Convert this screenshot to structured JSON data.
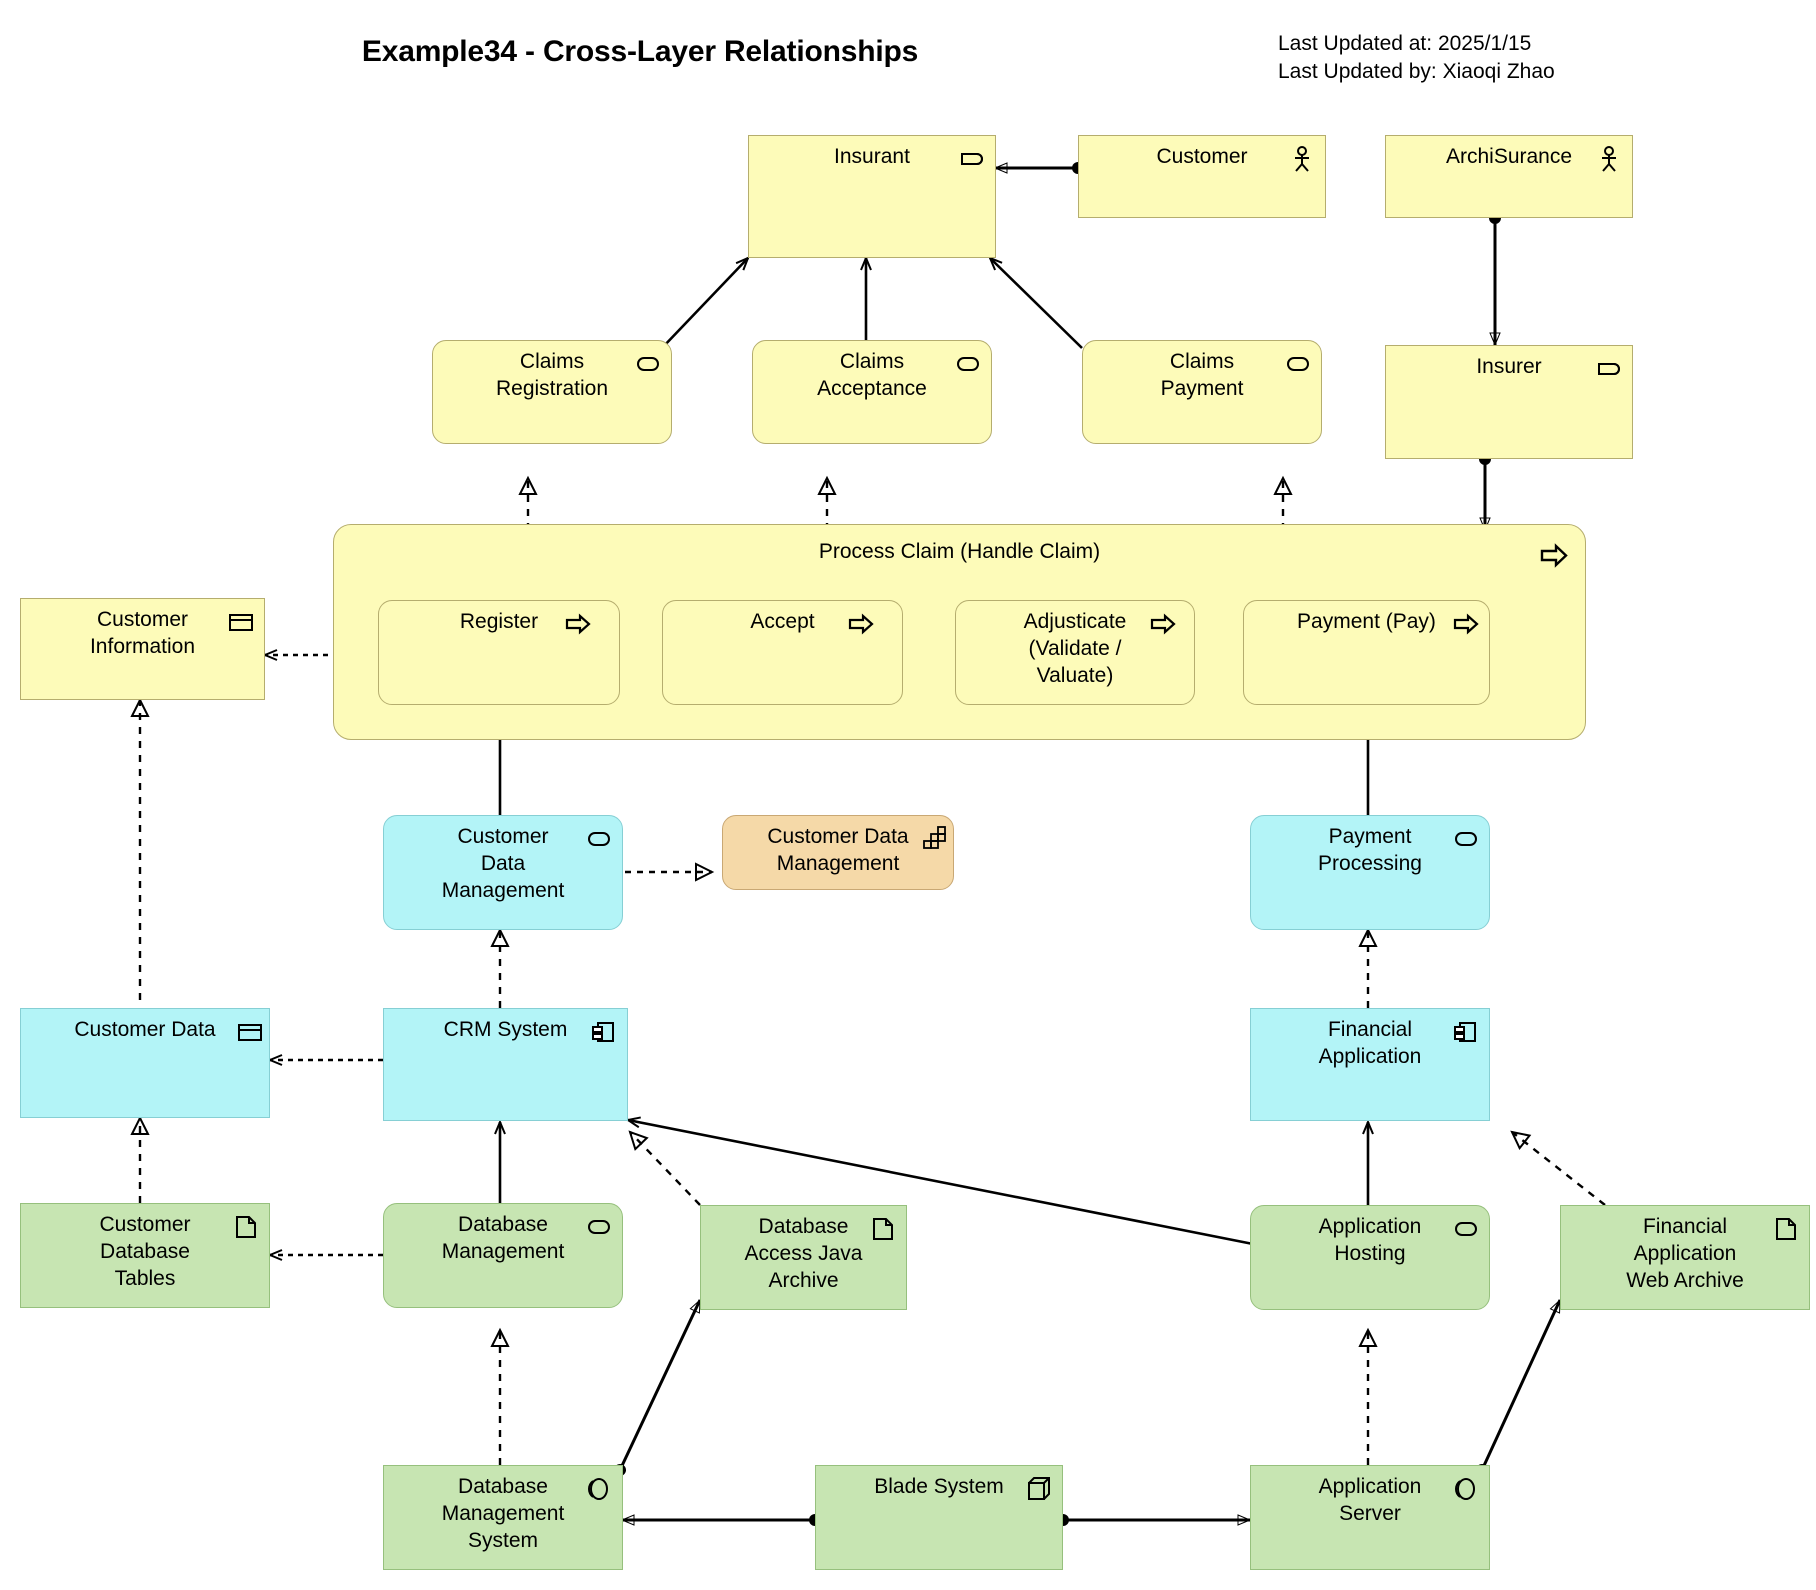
{
  "header": {
    "title": "Example34 - Cross-Layer Relationships",
    "last_updated_at": "Last Updated at: 2025/1/15",
    "last_updated_by": "Last Updated by: Xiaoqi Zhao"
  },
  "colors": {
    "business_fill": "#fdfbb9",
    "business_stroke": "#b5ad6e",
    "application_fill": "#b3f4f7",
    "application_stroke": "#86cfd4",
    "technology_fill": "#c7e5b2",
    "technology_stroke": "#96c07d",
    "motivation_fill": "#f5d9a8",
    "motivation_stroke": "#c9a874",
    "line": "#000000"
  },
  "nodes": {
    "insurant": {
      "label": "Insurant",
      "icon": "business-role-icon",
      "layer": "business"
    },
    "customer": {
      "label": "Customer",
      "icon": "business-actor-icon",
      "layer": "business"
    },
    "archisurance": {
      "label": "ArchiSurance",
      "icon": "business-actor-icon",
      "layer": "business"
    },
    "insurer": {
      "label": "Insurer",
      "icon": "business-role-icon",
      "layer": "business"
    },
    "claims_registration": {
      "label": "Claims\nRegistration",
      "icon": "business-service-icon",
      "layer": "business"
    },
    "claims_acceptance": {
      "label": "Claims\nAcceptance",
      "icon": "business-service-icon",
      "layer": "business"
    },
    "claims_payment": {
      "label": "Claims\nPayment",
      "icon": "business-service-icon",
      "layer": "business"
    },
    "process_claim": {
      "label": "Process Claim (Handle Claim)",
      "icon": "business-process-icon",
      "layer": "business"
    },
    "register": {
      "label": "Register",
      "icon": "business-process-icon",
      "layer": "business"
    },
    "accept": {
      "label": "Accept",
      "icon": "business-process-icon",
      "layer": "business"
    },
    "adjusticate": {
      "label": "Adjusticate\n(Validate /\nValuate)",
      "icon": "business-process-icon",
      "layer": "business"
    },
    "payment_pay": {
      "label": "Payment (Pay)",
      "icon": "business-process-icon",
      "layer": "business"
    },
    "customer_information": {
      "label": "Customer\nInformation",
      "icon": "business-object-icon",
      "layer": "business"
    },
    "customer_data_management_svc": {
      "label": "Customer\nData\nManagement",
      "icon": "application-service-icon",
      "layer": "application"
    },
    "customer_data_management_cap": {
      "label": "Customer Data\nManagement",
      "icon": "capability-icon",
      "layer": "motivation"
    },
    "payment_processing": {
      "label": "Payment\nProcessing",
      "icon": "application-service-icon",
      "layer": "application"
    },
    "customer_data": {
      "label": "Customer Data",
      "icon": "data-object-icon",
      "layer": "application"
    },
    "crm_system": {
      "label": "CRM System",
      "icon": "application-component-icon",
      "layer": "application"
    },
    "financial_application": {
      "label": "Financial\nApplication",
      "icon": "application-component-icon",
      "layer": "application"
    },
    "customer_database_tables": {
      "label": "Customer\nDatabase\nTables",
      "icon": "artifact-icon",
      "layer": "technology"
    },
    "database_management": {
      "label": "Database\nManagement",
      "icon": "technology-service-icon",
      "layer": "technology"
    },
    "database_access_java_archive": {
      "label": "Database\nAccess Java\nArchive",
      "icon": "artifact-icon",
      "layer": "technology"
    },
    "application_hosting": {
      "label": "Application\nHosting",
      "icon": "technology-service-icon",
      "layer": "technology"
    },
    "financial_application_web_archive": {
      "label": "Financial\nApplication\nWeb Archive",
      "icon": "artifact-icon",
      "layer": "technology"
    },
    "database_management_system": {
      "label": "Database\nManagement\nSystem",
      "icon": "system-software-icon",
      "layer": "technology"
    },
    "blade_system": {
      "label": "Blade System",
      "icon": "node-icon",
      "layer": "technology"
    },
    "application_server": {
      "label": "Application\nServer",
      "icon": "system-software-icon",
      "layer": "technology"
    }
  }
}
